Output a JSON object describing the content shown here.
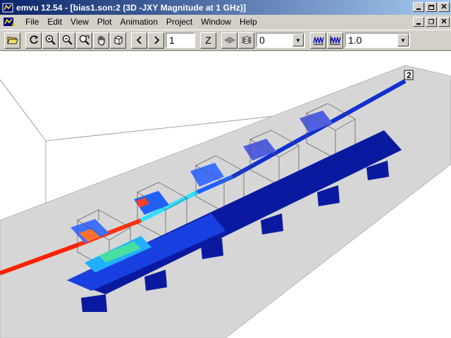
{
  "window": {
    "title": "emvu 12.54 - [bias1.son:2 (3D -JXY Magnitude at 1 GHz)]"
  },
  "menu": {
    "items": [
      {
        "label": "File",
        "key": "F"
      },
      {
        "label": "Edit",
        "key": "E"
      },
      {
        "label": "View",
        "key": "V"
      },
      {
        "label": "Plot",
        "key": "P"
      },
      {
        "label": "Animation",
        "key": "A"
      },
      {
        "label": "Project",
        "key": "r"
      },
      {
        "label": "Window",
        "key": "W"
      },
      {
        "label": "Help",
        "key": "H"
      }
    ]
  },
  "toolbar": {
    "level_value": "1",
    "z_label": "Z",
    "layer_select": "0",
    "scale_select": "1.0",
    "icons": [
      "open-icon",
      "refresh-icon",
      "zoom-fit-icon",
      "zoom-out-icon",
      "zoom-window-icon",
      "pan-icon",
      "rotate-3d-icon",
      "previous-icon",
      "next-icon",
      "z-axis-button",
      "mesh-icon",
      "layers-icon",
      "waveform-icon",
      "waveform-alt-icon"
    ]
  },
  "viewport": {
    "port_label": "2",
    "colors": {
      "high": "#ff2000",
      "mid": "#00e0ff",
      "low": "#1030d0",
      "base": "#0a1aa0"
    }
  }
}
